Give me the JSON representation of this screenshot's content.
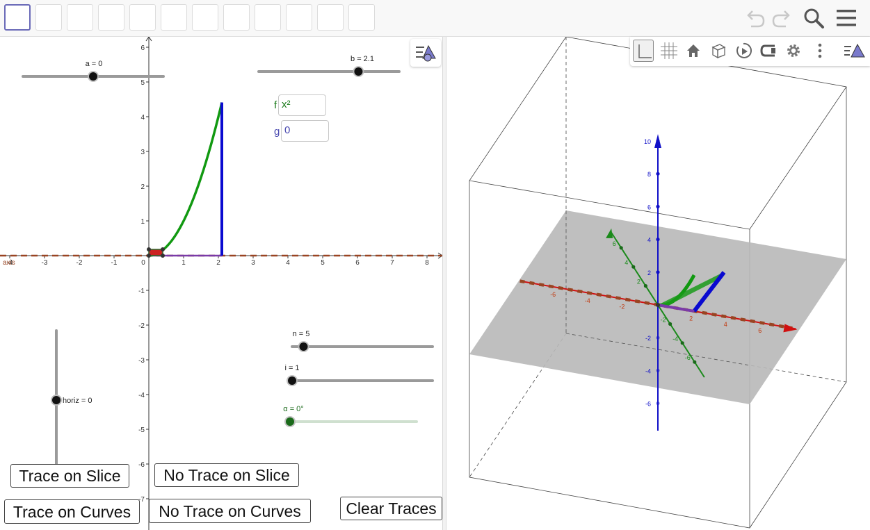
{
  "toolbar": {
    "tool_slot_count": 12,
    "undo_icon": "undo-icon",
    "redo_icon": "redo-icon",
    "search_icon": "search-icon",
    "menu_icon": "hamburger-menu-icon"
  },
  "graphics2d": {
    "x_ticks": [
      "-4",
      "-3",
      "-2",
      "-1",
      "0",
      "1",
      "2",
      "3",
      "4",
      "5",
      "6",
      "7",
      "8"
    ],
    "y_ticks": [
      "6",
      "5",
      "4",
      "3",
      "2",
      "1",
      "-1",
      "-2",
      "-3",
      "-4",
      "-5",
      "-6",
      "-7"
    ],
    "axis_label": "axis",
    "sliders": {
      "a": {
        "label": "a = 0",
        "value": 0,
        "min": -5,
        "max": 5
      },
      "b": {
        "label": "b = 2.1",
        "value": 2.1,
        "min": -5,
        "max": 5
      },
      "n": {
        "label": "n = 5",
        "value": 5,
        "min": 1,
        "max": 50
      },
      "i": {
        "label": "i = 1",
        "value": 1,
        "min": 1,
        "max": 50
      },
      "alpha": {
        "label": "α = 0°",
        "value": 0,
        "min": 0,
        "max": 360
      },
      "horiz": {
        "label": "horiz = 0",
        "value": 0,
        "min": -5,
        "max": 5
      }
    },
    "inputs": {
      "f_label": "f",
      "f_value": "x²",
      "g_label": "g",
      "g_value": "0"
    },
    "buttons": {
      "trace_on_slice": "Trace on Slice",
      "no_trace_on_slice": "No Trace on Slice",
      "trace_on_curves": "Trace on Curves",
      "no_trace_on_curves": "No Trace on Curves",
      "clear_traces": "Clear Traces"
    }
  },
  "graphics3d": {
    "z_ticks": [
      "10",
      "8",
      "6",
      "4",
      "2",
      "-2",
      "-4",
      "-6"
    ],
    "x_ticks": [
      "-6",
      "-4",
      "-2",
      "2",
      "4",
      "6"
    ],
    "y_ticks": [
      "-6",
      "-4",
      "-2",
      "2",
      "4",
      "6"
    ],
    "style_bar": [
      "axes-toggle-icon",
      "grid-toggle-icon",
      "home-icon",
      "view-direction-icon",
      "rotate-view-icon",
      "clipping-icon",
      "settings-gear-icon",
      "more-options-icon",
      "style-bar-toggle-icon"
    ]
  },
  "colors": {
    "curve_green": "#119911",
    "slice_blue": "#0a0ad0",
    "axis_dashed_brown": "#994422",
    "plane_gray": "#b8b8b8",
    "slider_gray": "#9a9a9a",
    "alpha_green": "#1a6a1a"
  }
}
